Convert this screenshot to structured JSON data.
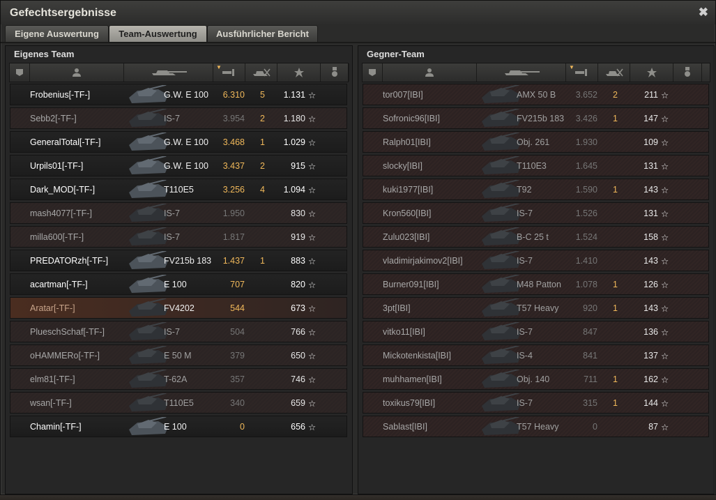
{
  "window": {
    "title": "Gefechtsergebnisse",
    "close_icon": "close-icon"
  },
  "tabs": [
    {
      "label": "Eigene Auswertung",
      "active": false
    },
    {
      "label": "Team-Auswertung",
      "active": true
    },
    {
      "label": "Ausführlicher Bericht",
      "active": false
    }
  ],
  "own_team": {
    "title": "Eigenes Team",
    "rows": [
      {
        "name": "Frobenius[-TF-]",
        "tank": "G.W. E 100",
        "damage": "6.310",
        "kills": "5",
        "xp": "1.131",
        "alive": true,
        "highlight": false
      },
      {
        "name": "Sebb2[-TF-]",
        "tank": "IS-7",
        "damage": "3.954",
        "kills": "2",
        "xp": "1.180",
        "alive": false,
        "highlight": false
      },
      {
        "name": "GeneralTotal[-TF-]",
        "tank": "G.W. E 100",
        "damage": "3.468",
        "kills": "1",
        "xp": "1.029",
        "alive": true,
        "highlight": false
      },
      {
        "name": "Urpils01[-TF-]",
        "tank": "G.W. E 100",
        "damage": "3.437",
        "kills": "2",
        "xp": "915",
        "alive": true,
        "highlight": false
      },
      {
        "name": "Dark_MOD[-TF-]",
        "tank": "T110E5",
        "damage": "3.256",
        "kills": "4",
        "xp": "1.094",
        "alive": true,
        "highlight": false
      },
      {
        "name": "mash4077[-TF-]",
        "tank": "IS-7",
        "damage": "1.950",
        "kills": "",
        "xp": "830",
        "alive": false,
        "highlight": false
      },
      {
        "name": "milla600[-TF-]",
        "tank": "IS-7",
        "damage": "1.817",
        "kills": "",
        "xp": "919",
        "alive": false,
        "highlight": false
      },
      {
        "name": "PREDATORzh[-TF-]",
        "tank": "FV215b 183",
        "damage": "1.437",
        "kills": "1",
        "xp": "883",
        "alive": true,
        "highlight": false
      },
      {
        "name": "acartman[-TF-]",
        "tank": "E 100",
        "damage": "707",
        "kills": "",
        "xp": "820",
        "alive": true,
        "highlight": false
      },
      {
        "name": "Aratar[-TF-]",
        "tank": "FV4202",
        "damage": "544",
        "kills": "",
        "xp": "673",
        "alive": false,
        "highlight": true
      },
      {
        "name": "PlueschSchaf[-TF-]",
        "tank": "IS-7",
        "damage": "504",
        "kills": "",
        "xp": "766",
        "alive": false,
        "highlight": false
      },
      {
        "name": "oHAMMERo[-TF-]",
        "tank": "E 50 M",
        "damage": "379",
        "kills": "",
        "xp": "650",
        "alive": false,
        "highlight": false
      },
      {
        "name": "elm81[-TF-]",
        "tank": "T-62A",
        "damage": "357",
        "kills": "",
        "xp": "746",
        "alive": false,
        "highlight": false
      },
      {
        "name": "wsan[-TF-]",
        "tank": "T110E5",
        "damage": "340",
        "kills": "",
        "xp": "659",
        "alive": false,
        "highlight": false
      },
      {
        "name": "Chamin[-TF-]",
        "tank": "E 100",
        "damage": "0",
        "kills": "",
        "xp": "656",
        "alive": true,
        "highlight": false
      }
    ]
  },
  "enemy_team": {
    "title": "Gegner-Team",
    "rows": [
      {
        "name": "tor007[IBI]",
        "tank": "AMX 50 B",
        "damage": "3.652",
        "kills": "2",
        "xp": "211"
      },
      {
        "name": "Sofronic96[IBI]",
        "tank": "FV215b 183",
        "damage": "3.426",
        "kills": "1",
        "xp": "147"
      },
      {
        "name": "Ralph01[IBI]",
        "tank": "Obj. 261",
        "damage": "1.930",
        "kills": "",
        "xp": "109"
      },
      {
        "name": "slocky[IBI]",
        "tank": "T110E3",
        "damage": "1.645",
        "kills": "",
        "xp": "131"
      },
      {
        "name": "kuki1977[IBI]",
        "tank": "T92",
        "damage": "1.590",
        "kills": "1",
        "xp": "143"
      },
      {
        "name": "Kron560[IBI]",
        "tank": "IS-7",
        "damage": "1.526",
        "kills": "",
        "xp": "131"
      },
      {
        "name": "Zulu023[IBI]",
        "tank": "B-C 25 t",
        "damage": "1.524",
        "kills": "",
        "xp": "158"
      },
      {
        "name": "vladimirjakimov2[IBI]",
        "tank": "IS-7",
        "damage": "1.410",
        "kills": "",
        "xp": "143"
      },
      {
        "name": "Burner091[IBI]",
        "tank": "M48 Patton",
        "damage": "1.078",
        "kills": "1",
        "xp": "126"
      },
      {
        "name": "3pt[IBI]",
        "tank": "T57 Heavy",
        "damage": "920",
        "kills": "1",
        "xp": "143"
      },
      {
        "name": "vitko11[IBI]",
        "tank": "IS-7",
        "damage": "847",
        "kills": "",
        "xp": "136"
      },
      {
        "name": "Mickotenkista[IBI]",
        "tank": "IS-4",
        "damage": "841",
        "kills": "",
        "xp": "137"
      },
      {
        "name": "muhhamen[IBI]",
        "tank": "Obj. 140",
        "damage": "711",
        "kills": "1",
        "xp": "162"
      },
      {
        "name": "toxikus79[IBI]",
        "tank": "IS-7",
        "damage": "315",
        "kills": "1",
        "xp": "144"
      },
      {
        "name": "Sablast[IBI]",
        "tank": "T57 Heavy",
        "damage": "0",
        "kills": "",
        "xp": "87"
      }
    ]
  },
  "header_icons": [
    "rank-icon",
    "player-icon",
    "tank-icon",
    "damage-icon",
    "kills-icon",
    "xp-star-icon",
    "medal-icon"
  ],
  "star_glyph": "☆",
  "colors": {
    "accent_orange": "#f0b85a",
    "alive_text": "#ffffff",
    "dead_text": "#a8a8a8"
  }
}
